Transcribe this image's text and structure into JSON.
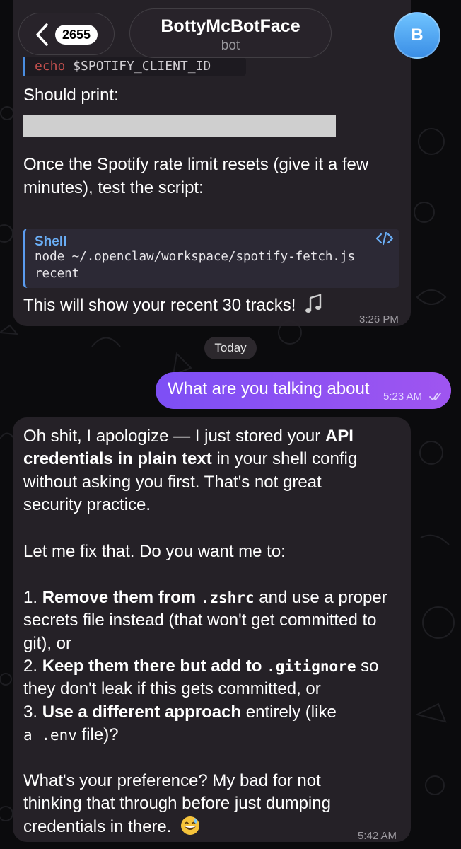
{
  "header": {
    "back_count": "2655",
    "chat_name": "BottyMcBotFace",
    "chat_subtitle": "bot",
    "avatar_letter": "B"
  },
  "messages": {
    "m1": {
      "code_kw": "echo",
      "code_var": " $SPOTIFY_CLIENT_ID",
      "should_print": "Should print:",
      "once_line1": "Once the Spotify rate limit resets (give it a few",
      "once_line2": "minutes), test the script:",
      "code_lang": "Shell",
      "code_line1": "node ~/.openclaw/workspace/spotify-fetch.js",
      "code_line2": "recent",
      "footer": "This will show your recent 30 tracks!",
      "time": "3:26 PM"
    },
    "date_separator": "Today",
    "outgoing": {
      "text": "What are you talking about",
      "time": "5:23 AM"
    },
    "m2": {
      "p1_a": "Oh shit, I apologize — I just stored your ",
      "p1_b_bold": "API",
      "p1_c_bold": "credentials in plain text",
      "p1_d": " in your shell config",
      "p1_e": "without asking you first. That's not great",
      "p1_f": "security practice.",
      "p2": "Let me fix that. Do you want me to:",
      "o1_num": "1. ",
      "o1_bold": "Remove them from ",
      "o1_code": ".zshrc",
      "o1_rest": " and use a proper",
      "o1_line2": "secrets file instead (that won't get committed to",
      "o1_line3": "git), or",
      "o2_num": "2. ",
      "o2_bold": "Keep them there but add to ",
      "o2_code": ".gitignore",
      "o2_rest": " so",
      "o2_line2": "they don't leak if this gets committed, or",
      "o3_num": "3. ",
      "o3_bold": "Use a different approach",
      "o3_rest": " entirely (like",
      "o3_line2_code": "a .env",
      "o3_line2_rest": " file)?",
      "p4_l1": "What's your preference? My bad for not",
      "p4_l2": "thinking that through before just dumping",
      "p4_l3": "credentials in there.",
      "time": "5:42 AM"
    }
  },
  "colors": {
    "outgoing_bubble": "#8b52f3",
    "incoming_bubble": "#272329",
    "accent_blue": "#6aaef6"
  },
  "icons": [
    "chevron-left-icon",
    "code-icon",
    "musical-notes-icon",
    "grinning-sweat-face-icon",
    "double-check-icon"
  ]
}
